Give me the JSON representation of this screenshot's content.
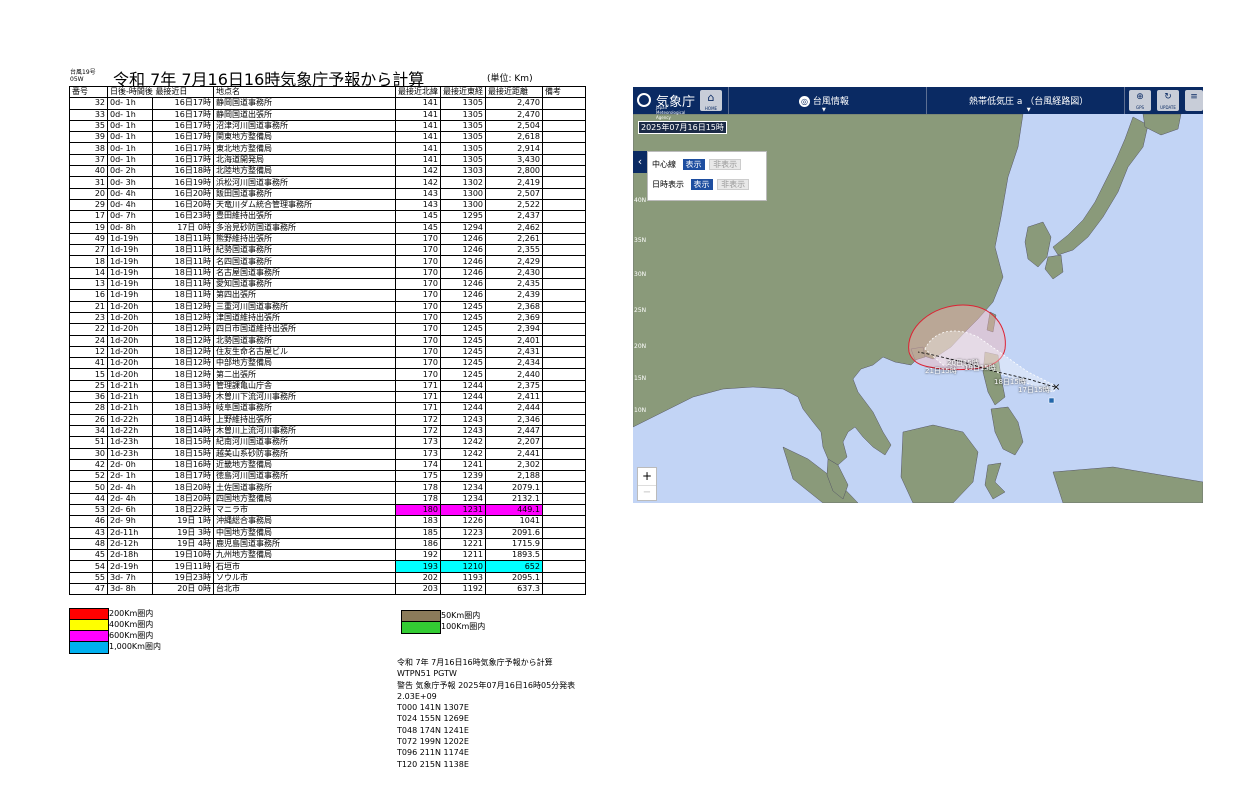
{
  "header": {
    "tag_line1": "台風19号",
    "tag_line2": "05W",
    "title": "令和 7年 7月16日16時気象庁予報から計算",
    "unit": "(単位: Km)"
  },
  "table": {
    "columns": [
      "番号",
      "日後-時間後",
      "最接近日",
      "地点名",
      "最接近北緯",
      "最接近東経",
      "最接近距離",
      "備考"
    ],
    "rows": [
      [
        "32",
        "0d- 1h",
        "16日17時",
        "静岡国道事務所",
        "141",
        "1305",
        "2,470",
        ""
      ],
      [
        "33",
        "0d- 1h",
        "16日17時",
        "静岡国道出張所",
        "141",
        "1305",
        "2,470",
        ""
      ],
      [
        "35",
        "0d- 1h",
        "16日17時",
        "沼津河川国道事務所",
        "141",
        "1305",
        "2,504",
        ""
      ],
      [
        "39",
        "0d- 1h",
        "16日17時",
        "関東地方整備局",
        "141",
        "1305",
        "2,618",
        ""
      ],
      [
        "38",
        "0d- 1h",
        "16日17時",
        "東北地方整備局",
        "141",
        "1305",
        "2,914",
        ""
      ],
      [
        "37",
        "0d- 1h",
        "16日17時",
        "北海道開発局",
        "141",
        "1305",
        "3,430",
        ""
      ],
      [
        "40",
        "0d- 2h",
        "16日18時",
        "北陸地方整備局",
        "142",
        "1303",
        "2,800",
        ""
      ],
      [
        "31",
        "0d- 3h",
        "16日19時",
        "浜松河川国道事務所",
        "142",
        "1302",
        "2,419",
        ""
      ],
      [
        "20",
        "0d- 4h",
        "16日20時",
        "飯田国道事務所",
        "143",
        "1300",
        "2,507",
        ""
      ],
      [
        "29",
        "0d- 4h",
        "16日20時",
        "天竜川ダム統合管理事務所",
        "143",
        "1300",
        "2,522",
        ""
      ],
      [
        "17",
        "0d- 7h",
        "16日23時",
        "豊田維持出張所",
        "145",
        "1295",
        "2,437",
        ""
      ],
      [
        "19",
        "0d- 8h",
        "17日 0時",
        "多治見砂防国道事務所",
        "145",
        "1294",
        "2,462",
        ""
      ],
      [
        "49",
        "1d-19h",
        "18日11時",
        "熊野維持出張所",
        "170",
        "1246",
        "2,261",
        ""
      ],
      [
        "27",
        "1d-19h",
        "18日11時",
        "紀勢国道事務所",
        "170",
        "1246",
        "2,355",
        ""
      ],
      [
        "18",
        "1d-19h",
        "18日11時",
        "名四国道事務所",
        "170",
        "1246",
        "2,429",
        ""
      ],
      [
        "14",
        "1d-19h",
        "18日11時",
        "名古屋国道事務所",
        "170",
        "1246",
        "2,430",
        ""
      ],
      [
        "13",
        "1d-19h",
        "18日11時",
        "愛知国道事務所",
        "170",
        "1246",
        "2,435",
        ""
      ],
      [
        "16",
        "1d-19h",
        "18日11時",
        "第四出張所",
        "170",
        "1246",
        "2,439",
        ""
      ],
      [
        "21",
        "1d-20h",
        "18日12時",
        "三重河川国道事務所",
        "170",
        "1245",
        "2,368",
        ""
      ],
      [
        "23",
        "1d-20h",
        "18日12時",
        "津国道維持出張所",
        "170",
        "1245",
        "2,369",
        ""
      ],
      [
        "22",
        "1d-20h",
        "18日12時",
        "四日市国道維持出張所",
        "170",
        "1245",
        "2,394",
        ""
      ],
      [
        "24",
        "1d-20h",
        "18日12時",
        "北勢国道事務所",
        "170",
        "1245",
        "2,401",
        ""
      ],
      [
        "12",
        "1d-20h",
        "18日12時",
        "住友生命名古屋ビル",
        "170",
        "1245",
        "2,431",
        ""
      ],
      [
        "41",
        "1d-20h",
        "18日12時",
        "中部地方整備局",
        "170",
        "1245",
        "2,434",
        ""
      ],
      [
        "15",
        "1d-20h",
        "18日12時",
        "第二出張所",
        "170",
        "1245",
        "2,440",
        ""
      ],
      [
        "25",
        "1d-21h",
        "18日13時",
        "管理課亀山庁舎",
        "171",
        "1244",
        "2,375",
        ""
      ],
      [
        "36",
        "1d-21h",
        "18日13時",
        "木曽川下流河川事務所",
        "171",
        "1244",
        "2,411",
        ""
      ],
      [
        "28",
        "1d-21h",
        "18日13時",
        "岐阜国道事務所",
        "171",
        "1244",
        "2,444",
        ""
      ],
      [
        "26",
        "1d-22h",
        "18日14時",
        "上野維持出張所",
        "172",
        "1243",
        "2,346",
        ""
      ],
      [
        "34",
        "1d-22h",
        "18日14時",
        "木曽川上流河川事務所",
        "172",
        "1243",
        "2,447",
        ""
      ],
      [
        "51",
        "1d-23h",
        "18日15時",
        "紀南河川国道事務所",
        "173",
        "1242",
        "2,207",
        ""
      ],
      [
        "30",
        "1d-23h",
        "18日15時",
        "越美山系砂防事務所",
        "173",
        "1242",
        "2,441",
        ""
      ],
      [
        "42",
        "2d- 0h",
        "18日16時",
        "近畿地方整備局",
        "174",
        "1241",
        "2,302",
        ""
      ],
      [
        "52",
        "2d- 1h",
        "18日17時",
        "徳島河川国道事務所",
        "175",
        "1239",
        "2,188",
        ""
      ],
      [
        "50",
        "2d- 4h",
        "18日20時",
        "土佐国道事務所",
        "178",
        "1234",
        "2079.1",
        ""
      ],
      [
        "44",
        "2d- 4h",
        "18日20時",
        "四国地方整備局",
        "178",
        "1234",
        "2132.1",
        ""
      ],
      [
        "53",
        "2d- 6h",
        "18日22時",
        "マニラ市",
        "180",
        "1231",
        "449.1",
        ""
      ],
      [
        "46",
        "2d- 9h",
        "19日 1時",
        "沖縄総合事務局",
        "183",
        "1226",
        "1041",
        ""
      ],
      [
        "43",
        "2d-11h",
        "19日 3時",
        "中国地方整備局",
        "185",
        "1223",
        "2091.6",
        ""
      ],
      [
        "48",
        "2d-12h",
        "19日 4時",
        "鹿児島国道事務所",
        "186",
        "1221",
        "1715.9",
        ""
      ],
      [
        "45",
        "2d-18h",
        "19日10時",
        "九州地方整備局",
        "192",
        "1211",
        "1893.5",
        ""
      ],
      [
        "54",
        "2d-19h",
        "19日11時",
        "石垣市",
        "193",
        "1210",
        "652",
        ""
      ],
      [
        "55",
        "3d- 7h",
        "19日23時",
        "ソウル市",
        "202",
        "1193",
        "2095.1",
        ""
      ],
      [
        "47",
        "3d- 8h",
        "20日 0時",
        "台北市",
        "203",
        "1192",
        "637.3",
        ""
      ]
    ],
    "highlight_magenta_row": 36,
    "highlight_cyan_rows": [
      41,
      44
    ],
    "color_magenta": "#ff00ff",
    "color_cyan": "#00ffff"
  },
  "legend": {
    "left": [
      {
        "label": "200Km圏内",
        "color": "#ff0000"
      },
      {
        "label": "400Km圏内",
        "color": "#ffff00"
      },
      {
        "label": "600Km圏内",
        "color": "#ff00ff"
      },
      {
        "label": "1,000Km圏内",
        "color": "#00b0f0"
      }
    ],
    "right": [
      {
        "label": "50Km圏内",
        "color": "#8b7b5a"
      },
      {
        "label": "100Km圏内",
        "color": "#33cc33"
      }
    ]
  },
  "notes": [
    "令和 7年 7月16日16時気象庁予報から計算",
    "WTPN51 PGTW",
    "警告  気象庁予報 2025年07月16日16時05分発表",
    " 2.03E+09",
    "T000 141N 1307E",
    "T024 155N 1269E",
    "T048 174N 1241E",
    "T072 199N 1202E",
    "T096 211N 1174E",
    "T120 215N 1138E"
  ],
  "map": {
    "logo_name": "気象庁",
    "logo_sub": "Japan Meteorological Agency",
    "home_label": "HOME",
    "nav_typhoon": "台風情報",
    "nav_tropical": "熱帯低気圧 a （台風経路図）",
    "gps_label": "GPS",
    "update_label": "UPDATE",
    "date_badge": "2025年07月16日15時",
    "ctrl_center_label": "中心線",
    "ctrl_date_label": "日時表示",
    "show_label": "表示",
    "hide_label": "非表示",
    "lat_labels": [
      "40N",
      "35N",
      "30N",
      "25N",
      "20N",
      "15N",
      "10N"
    ],
    "track_labels": [
      "20日15時",
      "21日15時",
      "19日15時",
      "18日15時",
      "17日15時"
    ],
    "zoom_in": "+",
    "zoom_out": "−",
    "color_header": "#0a2a63",
    "color_sea": "#c2d4f5",
    "color_land": "#8a9a7a"
  }
}
